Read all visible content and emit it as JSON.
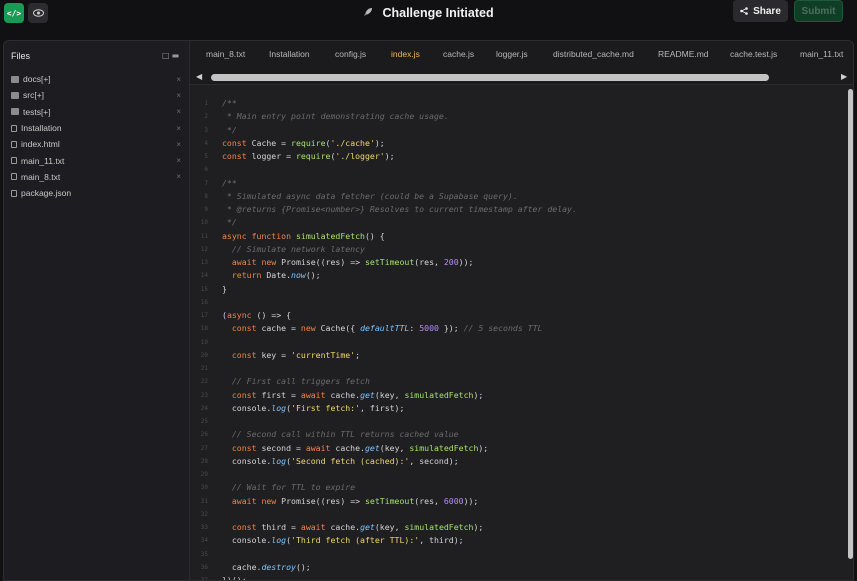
{
  "header": {
    "code_toggle_icon": "code-icon",
    "preview_toggle_icon": "eye-icon",
    "title": "Challenge Initiated",
    "title_icon": "rocket-icon",
    "share_label": "Share",
    "submit_label": "Submit"
  },
  "sidebar": {
    "heading": "Files",
    "items": [
      {
        "label": "docs[+]",
        "type": "folder"
      },
      {
        "label": "src[+]",
        "type": "folder"
      },
      {
        "label": "tests[+]",
        "type": "folder"
      },
      {
        "label": "Installation",
        "type": "file"
      },
      {
        "label": "index.html",
        "type": "file"
      },
      {
        "label": "main_11.txt",
        "type": "file"
      },
      {
        "label": "main_8.txt",
        "type": "file"
      },
      {
        "label": "package.json",
        "type": "file"
      }
    ]
  },
  "tabs": [
    {
      "label": "main_8.txt",
      "active": false
    },
    {
      "label": "Installation",
      "active": false
    },
    {
      "label": "config.js",
      "active": false
    },
    {
      "label": "index.js",
      "active": true
    },
    {
      "label": "cache.js",
      "active": false
    },
    {
      "label": "logger.js",
      "active": false
    },
    {
      "label": "distributed_cache.md",
      "active": false
    },
    {
      "label": "README.md",
      "active": false
    },
    {
      "label": "cache.test.js",
      "active": false
    },
    {
      "label": "main_11.txt",
      "active": false
    }
  ],
  "editor": {
    "language": "javascript",
    "lines": [
      "/**",
      " * Main entry point demonstrating cache usage.",
      " */",
      "const Cache = require('./cache');",
      "const logger = require('./logger');",
      "",
      "/**",
      " * Simulated async data fetcher (could be a Supabase query).",
      " * @returns {Promise<number>} Resolves to current timestamp after delay.",
      " */",
      "async function simulatedFetch() {",
      "  // Simulate network latency",
      "  await new Promise((res) => setTimeout(res, 200));",
      "  return Date.now();",
      "}",
      "",
      "(async () => {",
      "  const cache = new Cache({ defaultTTL: 5000 }); // 5 seconds TTL",
      "",
      "  const key = 'currentTime';",
      "",
      "  // First call triggers fetch",
      "  const first = await cache.get(key, simulatedFetch);",
      "  console.log('First fetch:', first);",
      "",
      "  // Second call within TTL returns cached value",
      "  const second = await cache.get(key, simulatedFetch);",
      "  console.log('Second fetch (cached):', second);",
      "",
      "  // Wait for TTL to expire",
      "  await new Promise((res) => setTimeout(res, 6000));",
      "",
      "  const third = await cache.get(key, simulatedFetch);",
      "  console.log('Third fetch (after TTL):', third);",
      "",
      "  cache.destroy();",
      "})();"
    ]
  },
  "colors": {
    "accent_green": "#179b55",
    "active_tab": "#f0b84a",
    "keyword": "#f2834a",
    "function": "#a6e26b",
    "string": "#f0d76a",
    "number": "#b58cf5",
    "comment": "#6b6b70"
  }
}
